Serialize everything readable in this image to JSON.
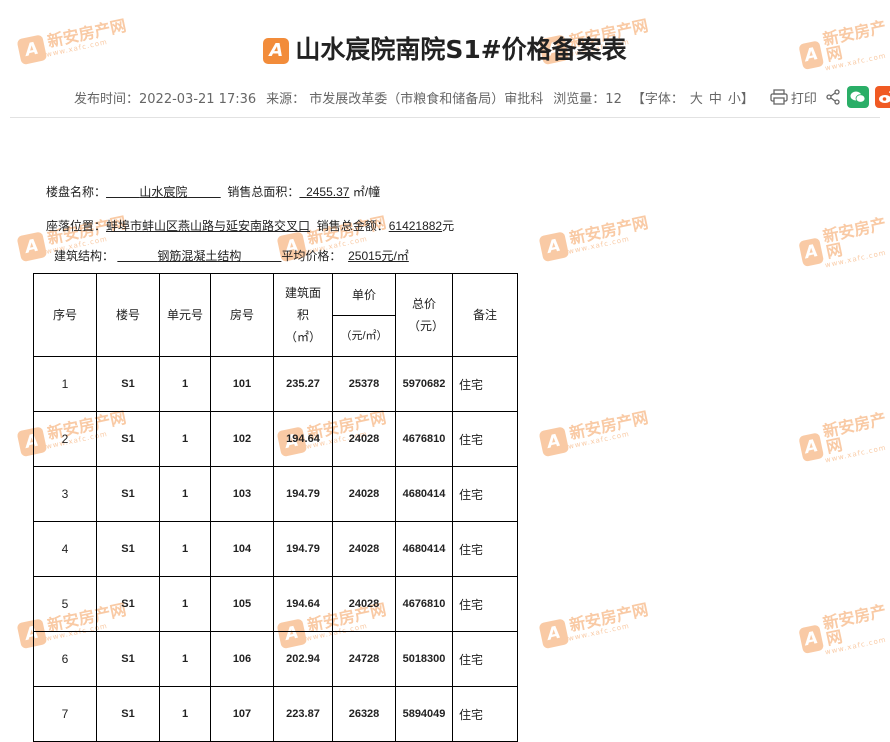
{
  "page": {
    "title": "山水宸院南院S1#价格备案表",
    "meta": {
      "publish_time": "发布时间：2022-03-21 17:36",
      "source": "来源：  市发展改革委（市粮食和储备局）审批科",
      "views": "浏览量：12",
      "font_label": "【字体：",
      "font_large": "大",
      "font_medium": "中",
      "font_small": "小】",
      "print": "打印"
    },
    "watermark": {
      "brand": "新安房产网",
      "domain": "www.xafc.com"
    }
  },
  "info": {
    "project_label": "楼盘名称：",
    "project_value": "山水宸院",
    "area_label": "销售总面积：",
    "area_value": "2455.37",
    "area_unit": "㎡/幢",
    "location_label": "座落位置：",
    "location_value": "蚌埠市蚌山区燕山路与延安南路交叉口",
    "total_label": "销售总金额：",
    "total_value": "61421882",
    "total_unit": "元",
    "structure_label": "建筑结构：",
    "structure_value": "钢筋混凝土结构",
    "avg_label": "平均价格：",
    "avg_value": "25015元/㎡"
  },
  "table": {
    "headers": {
      "seq": "序号",
      "building": "楼号",
      "unit": "单元号",
      "room": "房号",
      "area": "建筑面积（㎡）",
      "unit_price_top": "单价",
      "unit_price_bottom": "（元/㎡）",
      "total": "总价（元）",
      "note": "备注"
    },
    "rows": [
      {
        "seq": "1",
        "building": "S1",
        "unit": "1",
        "room": "101",
        "area": "235.27",
        "price": "25378",
        "total": "5970682",
        "note": "住宅"
      },
      {
        "seq": "2",
        "building": "S1",
        "unit": "1",
        "room": "102",
        "area": "194.64",
        "price": "24028",
        "total": "4676810",
        "note": "住宅"
      },
      {
        "seq": "3",
        "building": "S1",
        "unit": "1",
        "room": "103",
        "area": "194.79",
        "price": "24028",
        "total": "4680414",
        "note": "住宅"
      },
      {
        "seq": "4",
        "building": "S1",
        "unit": "1",
        "room": "104",
        "area": "194.79",
        "price": "24028",
        "total": "4680414",
        "note": "住宅"
      },
      {
        "seq": "5",
        "building": "S1",
        "unit": "1",
        "room": "105",
        "area": "194.64",
        "price": "24028",
        "total": "4676810",
        "note": "住宅"
      },
      {
        "seq": "6",
        "building": "S1",
        "unit": "1",
        "room": "106",
        "area": "202.94",
        "price": "24728",
        "total": "5018300",
        "note": "住宅"
      },
      {
        "seq": "7",
        "building": "S1",
        "unit": "1",
        "room": "107",
        "area": "223.87",
        "price": "26328",
        "total": "5894049",
        "note": "住宅"
      }
    ]
  },
  "colors": {
    "wechat": "#2aae67",
    "weibo": "#f05a23",
    "favorite": "#f5a623",
    "watermark": "#f28c3a"
  }
}
